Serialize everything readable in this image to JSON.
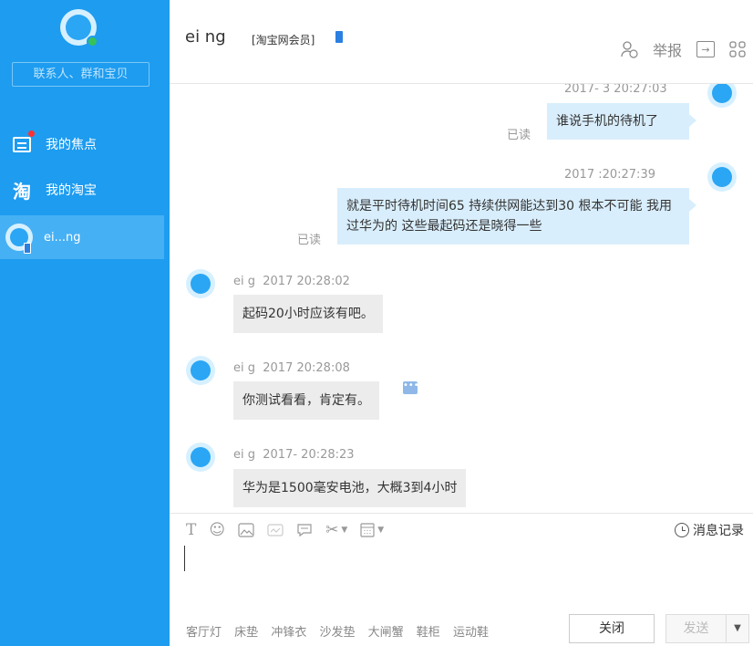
{
  "sidebar": {
    "search_placeholder": "联系人、群和宝贝",
    "nav": [
      {
        "label": "我的焦点",
        "icon": "focus-icon"
      },
      {
        "label": "我的淘宝",
        "icon": "taobao-icon"
      }
    ],
    "contact": {
      "name": "ei...ng",
      "icon": "mobile-icon"
    }
  },
  "header": {
    "name": "ei    ng",
    "member": "[淘宝网会员]",
    "tools": {
      "add_contact_icon": "add-contact-icon",
      "report_label": "举报",
      "forward_icon": "share-icon",
      "grid_icon": "apps-icon"
    }
  },
  "messages": [
    {
      "dir": "out",
      "time": "2017-   3 20:27:03",
      "status": "已读",
      "text": "谁说手机的待机了"
    },
    {
      "dir": "out",
      "time": "2017   :20:27:39",
      "status": "已读",
      "text": "就是平时待机时间65   持续供网能达到30  根本不可能  我用过华为的  这些最起码还是晓得一些"
    },
    {
      "dir": "in",
      "sender": "ei   g",
      "time": "2017      20:28:02",
      "text": "起码20小时应该有吧。"
    },
    {
      "dir": "in",
      "sender": "ei   g",
      "time": "2017      20:28:08",
      "text": "你测试看看，肯定有。"
    },
    {
      "dir": "in",
      "sender": "ei   g",
      "time": "2017-     20:28:23",
      "text": "华为是1500毫安电池，大概3到4小时"
    }
  ],
  "toolbar": {
    "history_label": "消息记录"
  },
  "footer": {
    "suggestions": [
      "客厅灯",
      "床垫",
      "冲锋衣",
      "沙发垫",
      "大闸蟹",
      "鞋柜",
      "运动鞋"
    ],
    "close_label": "关闭",
    "send_label": "发送"
  }
}
